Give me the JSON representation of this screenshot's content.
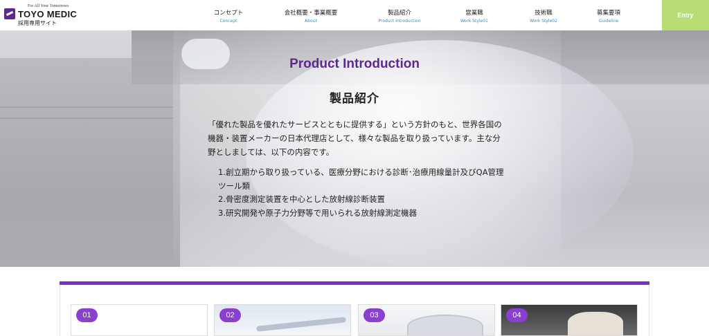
{
  "header": {
    "logo": {
      "tagline": "For All Your Tomorrows",
      "name": "TOYO MEDIC",
      "subtitle": "採用専用サイト"
    },
    "nav": [
      {
        "ja": "コンセプト",
        "en": "Concept"
      },
      {
        "ja": "会社概要・事業概要",
        "en": "About"
      },
      {
        "ja": "製品紹介",
        "en": "Product Introduction"
      },
      {
        "ja": "営業職",
        "en": "Work Style01"
      },
      {
        "ja": "技術職",
        "en": "Work Style02"
      },
      {
        "ja": "募集要項",
        "en": "Guideline"
      }
    ],
    "entry_label": "Entry"
  },
  "hero": {
    "title_en": "Product Introduction",
    "title_ja": "製品紹介",
    "description": "「優れた製品を優れたサービスとともに提供する」という方針のもと、世界各国の機器・装置メーカーの日本代理店として、様々な製品を取り扱っています。主な分野としましては、以下の内容です。",
    "items": [
      "1.創立期から取り扱っている、医療分野における診断･治療用線量計及びQA管理ツール類",
      "2.骨密度測定装置を中心とした放射線診断装置",
      "3.研究開発や原子力分野等で用いられる放射線測定機器"
    ]
  },
  "products": {
    "cards": [
      {
        "number": "01"
      },
      {
        "number": "02"
      },
      {
        "number": "03"
      },
      {
        "number": "04"
      }
    ]
  },
  "colors": {
    "brand_purple": "#5b2a8e",
    "accent_purple": "#7d2fc0",
    "entry_green": "#b7dd74",
    "nav_en_blue": "#3a8fb7"
  }
}
